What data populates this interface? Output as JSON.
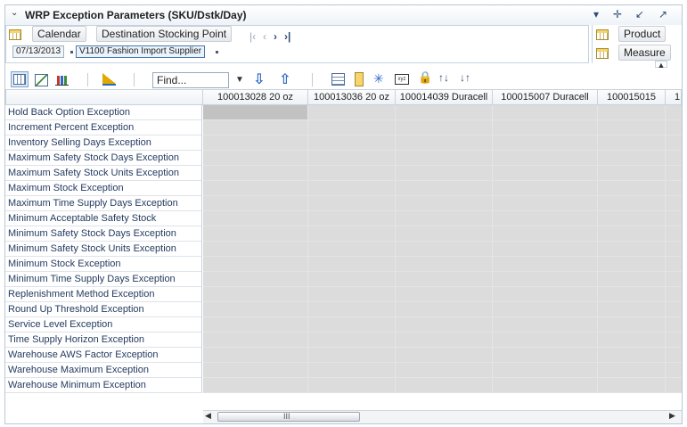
{
  "window": {
    "title": "WRP Exception Parameters (SKU/Dstk/Day)"
  },
  "pivot": {
    "row_tiles": [
      "Calendar",
      "Destination Stocking Point"
    ],
    "filters": [
      "07/13/2013",
      "V1100 Fashion Import Supplier"
    ],
    "right_tiles": [
      "Product",
      "Measure"
    ]
  },
  "toolbar": {
    "find_placeholder": "Find..."
  },
  "grid": {
    "columns": [
      "100013028 20 oz",
      "100013036 20 oz",
      "100014039 Duracell",
      "100015007 Duracell",
      "100015015",
      "1"
    ],
    "rows": [
      "Hold Back Option Exception",
      "Increment Percent Exception",
      "Inventory Selling Days Exception",
      "Maximum Safety Stock Days Exception",
      "Maximum Safety Stock Units Exception",
      "Maximum Stock Exception",
      "Maximum Time Supply Days Exception",
      "Minimum Acceptable Safety Stock",
      "Minimum Safety Stock Days Exception",
      "Minimum Safety Stock Units Exception",
      "Minimum Stock Exception",
      "Minimum Time Supply Days Exception",
      "Replenishment Method Exception",
      "Round Up Threshold Exception",
      "Service Level Exception",
      "Time Supply Horizon Exception",
      "Warehouse AWS Factor Exception",
      "Warehouse Maximum Exception",
      "Warehouse Minimum Exception"
    ]
  },
  "scrollbar": {
    "grip": "III"
  },
  "colors": {
    "header_text": "#243b60",
    "grid_fill": "#dcdcdc",
    "selected_cell": "#c2c2c2",
    "accent_blue": "#2b67c4"
  }
}
